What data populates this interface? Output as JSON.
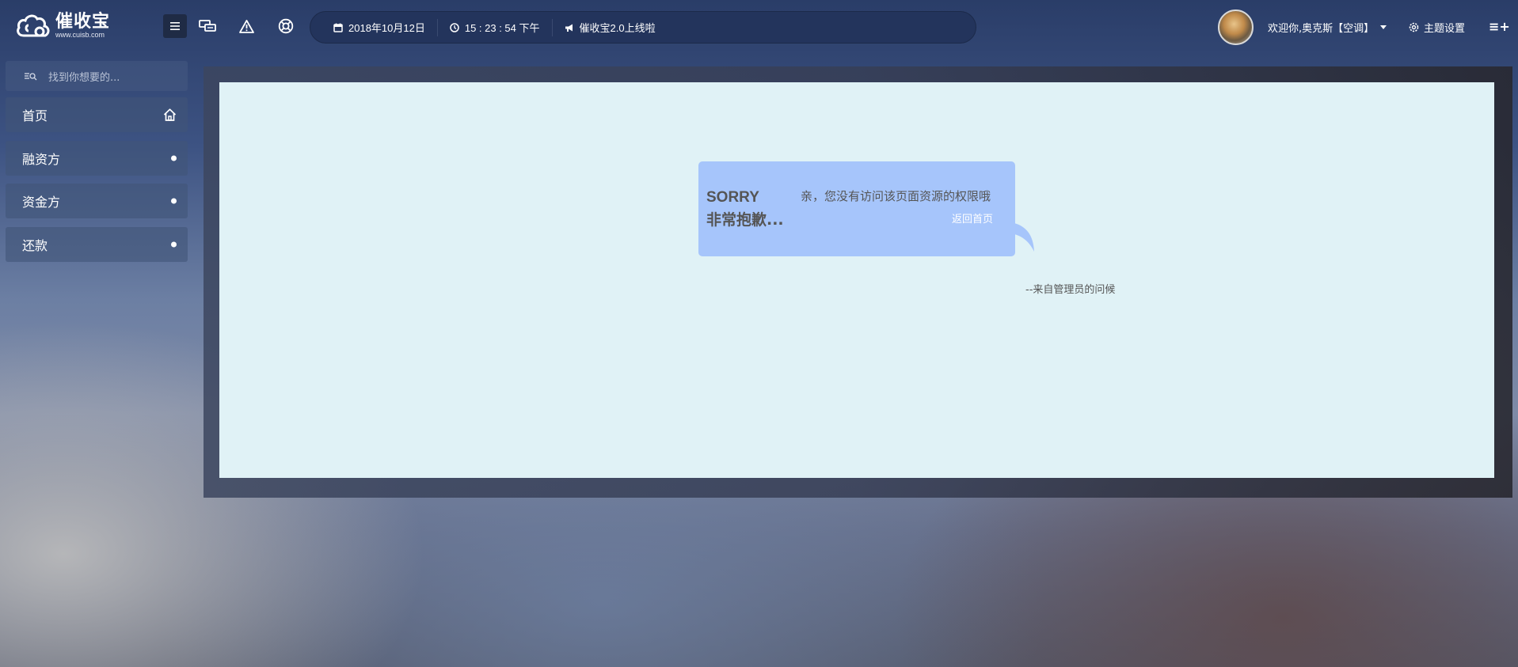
{
  "logo": {
    "brand": "催收宝",
    "domain": "www.cuisb.com"
  },
  "toolbar": {
    "icons": [
      "menu-icon",
      "message-icon",
      "warning-icon",
      "help-icon"
    ]
  },
  "info_bar": {
    "date": "2018年10月12日",
    "time": "15 : 23 : 54 下午",
    "announcement": "催收宝2.0上线啦"
  },
  "user": {
    "welcome": "欢迎你,奥克斯【空调】"
  },
  "theme_settings": "主题设置",
  "more_icon": "≡+",
  "sidebar": {
    "search_placeholder": "找到你想要的...",
    "items": [
      {
        "label": "首页",
        "icon": "home-icon"
      },
      {
        "label": "融资方",
        "icon": "dot-icon"
      },
      {
        "label": "资金方",
        "icon": "dot-icon"
      },
      {
        "label": "还款",
        "icon": "dot-icon"
      }
    ]
  },
  "error": {
    "sorry": "SORRY",
    "apology": "非常抱歉...",
    "message": "亲，您没有访问该页面资源的权限哦",
    "back_link": "返回首页",
    "signature": "--来自管理员的问候"
  },
  "colors": {
    "topbar_pill": "#23345c",
    "panel": "#e0f2f6",
    "bubble": "#a6c5fb"
  }
}
